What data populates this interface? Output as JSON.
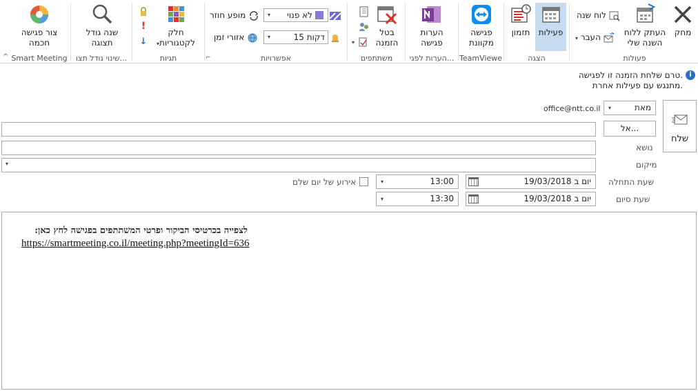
{
  "ribbon": {
    "groups": {
      "actions": "פעולות",
      "show": "הצגה",
      "teamviewer": "TeamViewer",
      "meeting_notes": "הערות לפגי...",
      "attendees": "משתתפים",
      "options": "אפשרויות",
      "tags": "תגיות",
      "zoom": "שינוי גודל תצו...",
      "smart_meeting": "Smart Meeting"
    },
    "delete_label": "מחק",
    "copy_calendar_label_1": "העתק ללוח",
    "copy_calendar_label_2": "השנה שלי",
    "calendar_label": "לוח שנה",
    "forward_label": "העבר",
    "appointment_label": "פעילות",
    "scheduling_label": "תזמון",
    "teamviewer_label_1": "פגישה",
    "teamviewer_label_2": "מקוונת",
    "notes_label_1": "הערות",
    "notes_label_2": "פגישה",
    "cancel_label_1": "בטל",
    "cancel_label_2": "הזמנה",
    "show_as_value": "לא פנוי",
    "reminder_value": "15 דקות",
    "recurrence_label": "מופע חוזר",
    "timezones_label": "אזורי זמן",
    "categorize_label_1": "חלק",
    "categorize_label_2": "לקטגוריות",
    "zoom_label_1": "שנה גודל",
    "zoom_label_2": "תצוגה",
    "smart_label_1": "צור פגישה",
    "smart_label_2": "חכמה"
  },
  "info": {
    "line1": "טרם שלחת הזמנה זו לפגישה.",
    "line2": "מתנגש עם פעילות אחרת."
  },
  "form": {
    "send_label": "שלח",
    "from_label": "מאת",
    "from_value": "office@ntt.co.il",
    "to_button": "אל...",
    "subject_label": "נושא",
    "location_label": "מיקום",
    "start_label": "שעת התחלה",
    "end_label": "שעת סיום",
    "start_date": "יום ב 19/03/2018",
    "start_time": "13:00",
    "end_date": "יום ב 19/03/2018",
    "end_time": "13:30",
    "all_day_label": "אירוע של יום שלם"
  },
  "body": {
    "line1": "לצפייה בכרטיסי הביקור ופרטי המשתתפים בפגישה לחץ כאן:",
    "link": "https://smartmeeting.co.il/meeting.php?meetingId=636"
  },
  "colors": {
    "accent": "#2b6fbf",
    "active_button": "#c7dcf0",
    "onenote": "#7b3a96",
    "teamviewer": "#0e8ee9",
    "delete": "#444444"
  }
}
